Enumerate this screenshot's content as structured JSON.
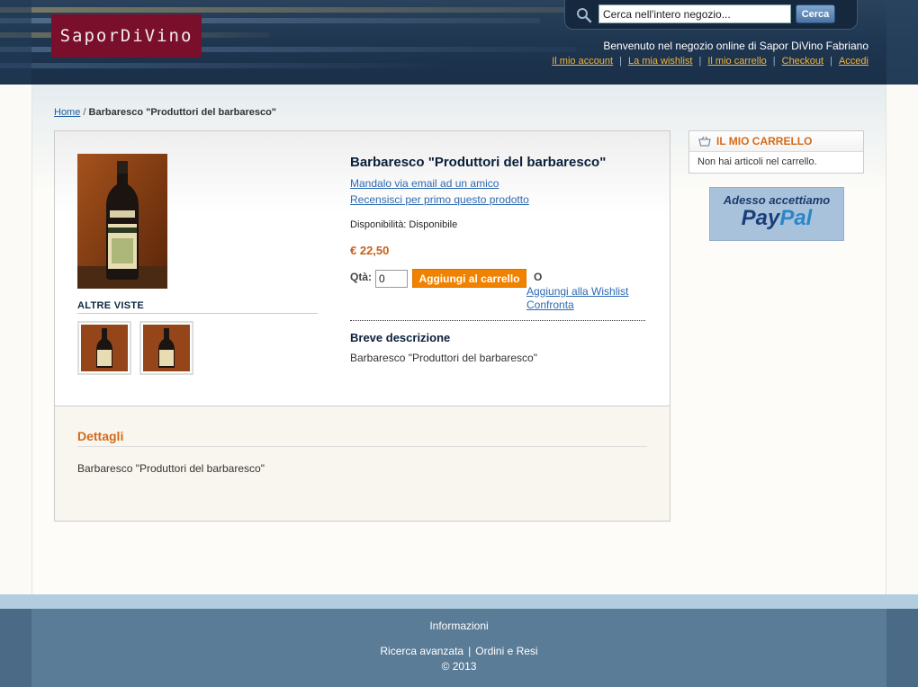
{
  "header": {
    "logo_text": "SaporDiVino",
    "search": {
      "placeholder": "Cerca nell'intero negozio...",
      "value": "Cerca nell'intero negozio...",
      "button_label": "Cerca"
    },
    "welcome": "Benvenuto nel negozio online di Sapor DiVino Fabriano",
    "links": [
      "Il mio account",
      "La mia wishlist",
      "Il mio carrello",
      "Checkout",
      "Accedi"
    ]
  },
  "breadcrumb": {
    "home": "Home",
    "separator": "/",
    "current": "Barbaresco \"Produttori del barbaresco\""
  },
  "product": {
    "title": "Barbaresco \"Produttori del barbaresco\"",
    "email_link": "Mandalo via email ad un amico",
    "review_link": "Recensisci per primo questo prodotto",
    "availability": "Disponibilità: Disponibile",
    "price": "€ 22,50",
    "qty_label": "Qtà:",
    "qty_value": "0",
    "add_to_cart": "Aggiungi al carrello",
    "or": "O",
    "wishlist_link": "Aggiungi alla Wishlist",
    "compare_link": "Confronta",
    "more_views": "ALTRE VISTE",
    "short_desc_heading": "Breve descrizione",
    "short_desc": "Barbaresco \"Produttori del barbaresco\""
  },
  "details": {
    "heading": "Dettagli",
    "text": "Barbaresco \"Produttori del barbaresco\""
  },
  "sidebar": {
    "cart_title": "IL MIO CARRELLO",
    "cart_empty": "Non hai articoli nel carrello.",
    "paypal_top": "Adesso accettiamo",
    "paypal_logo_a": "Pay",
    "paypal_logo_b": "Pal"
  },
  "footer": {
    "info": "Informazioni",
    "links": [
      "Ricerca avanzata",
      "Ordini e Resi"
    ],
    "separator": "|",
    "copyright": "© 2013"
  },
  "colors": {
    "header_bg": "#1e3550",
    "accent_orange": "#f18200",
    "logo_bg": "#7a0f2c",
    "link_blue": "#2d6ab2",
    "footer_bg": "#5a7c97"
  }
}
